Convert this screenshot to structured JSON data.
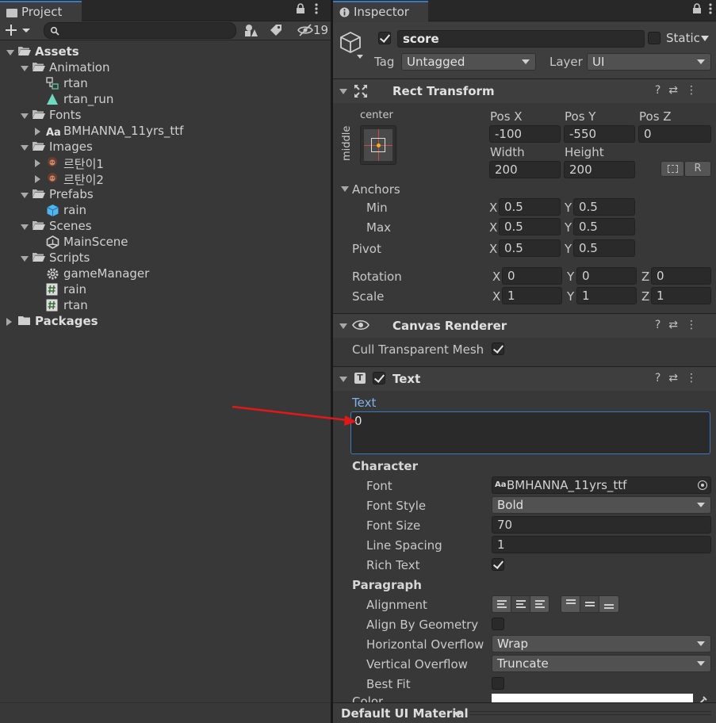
{
  "project": {
    "tab_label": "Project",
    "hidden_count": "19",
    "search_placeholder": "",
    "tree": [
      {
        "label": "Assets",
        "indent": 0,
        "icon": "folder-open-icon",
        "expander": "down",
        "bold": true
      },
      {
        "label": "Animation",
        "indent": 1,
        "icon": "folder-open-icon",
        "expander": "down",
        "bold": false
      },
      {
        "label": "rtan",
        "indent": 2,
        "icon": "animator-controller-icon",
        "expander": "none",
        "bold": false
      },
      {
        "label": "rtan_run",
        "indent": 2,
        "icon": "animation-clip-icon",
        "expander": "none",
        "bold": false
      },
      {
        "label": "Fonts",
        "indent": 1,
        "icon": "folder-open-icon",
        "expander": "down",
        "bold": false
      },
      {
        "label": "BMHANNA_11yrs_ttf",
        "indent": 2,
        "icon": "font-icon",
        "expander": "right",
        "bold": false
      },
      {
        "label": "Images",
        "indent": 1,
        "icon": "folder-open-icon",
        "expander": "down",
        "bold": false
      },
      {
        "label": "르탄이1",
        "indent": 2,
        "icon": "sprite-icon",
        "expander": "right",
        "bold": false
      },
      {
        "label": "르탄이2",
        "indent": 2,
        "icon": "sprite-icon",
        "expander": "right",
        "bold": false
      },
      {
        "label": "Prefabs",
        "indent": 1,
        "icon": "folder-open-icon",
        "expander": "down",
        "bold": false
      },
      {
        "label": "rain",
        "indent": 2,
        "icon": "prefab-icon",
        "expander": "none",
        "bold": false
      },
      {
        "label": "Scenes",
        "indent": 1,
        "icon": "folder-open-icon",
        "expander": "down",
        "bold": false
      },
      {
        "label": "MainScene",
        "indent": 2,
        "icon": "unity-scene-icon",
        "expander": "none",
        "bold": false
      },
      {
        "label": "Scripts",
        "indent": 1,
        "icon": "folder-open-icon",
        "expander": "down",
        "bold": false
      },
      {
        "label": "gameManager",
        "indent": 2,
        "icon": "gear-script-icon",
        "expander": "none",
        "bold": false
      },
      {
        "label": "rain",
        "indent": 2,
        "icon": "csharp-script-icon",
        "expander": "none",
        "bold": false
      },
      {
        "label": "rtan",
        "indent": 2,
        "icon": "csharp-script-icon",
        "expander": "none",
        "bold": false
      },
      {
        "label": "Packages",
        "indent": 0,
        "icon": "folder-closed-icon",
        "expander": "right",
        "bold": true
      }
    ]
  },
  "inspector": {
    "tab_label": "Inspector",
    "object_name": "score",
    "active": true,
    "static_label": "Static",
    "tag_label": "Tag",
    "tag_value": "Untagged",
    "layer_label": "Layer",
    "layer_value": "UI",
    "rect_transform": {
      "title": "Rect Transform",
      "anchor_h": "center",
      "anchor_v": "middle",
      "pos_x_label": "Pos X",
      "pos_y_label": "Pos Y",
      "pos_z_label": "Pos Z",
      "pos_x": "-100",
      "pos_y": "-550",
      "pos_z": "0",
      "width_label": "Width",
      "height_label": "Height",
      "width": "200",
      "height": "200",
      "r_button": "R",
      "anchors_label": "Anchors",
      "min_label": "Min",
      "max_label": "Max",
      "pivot_label": "Pivot",
      "min_x": "0.5",
      "min_y": "0.5",
      "max_x": "0.5",
      "max_y": "0.5",
      "pivot_x": "0.5",
      "pivot_y": "0.5",
      "rotation_label": "Rotation",
      "scale_label": "Scale",
      "rot_x": "0",
      "rot_y": "0",
      "rot_z": "0",
      "scale_x": "1",
      "scale_y": "1",
      "scale_z": "1",
      "x": "X",
      "y": "Y",
      "z": "Z"
    },
    "canvas_renderer": {
      "title": "Canvas Renderer",
      "cull_label": "Cull Transparent Mesh",
      "cull": true
    },
    "text": {
      "title": "Text",
      "enabled": true,
      "text_label": "Text",
      "text_value": "0",
      "character_label": "Character",
      "font_label": "Font",
      "font_value": "BMHANNA_11yrs_ttf",
      "font_style_label": "Font Style",
      "font_style_value": "Bold",
      "font_size_label": "Font Size",
      "font_size_value": "70",
      "line_spacing_label": "Line Spacing",
      "line_spacing_value": "1",
      "rich_text_label": "Rich Text",
      "rich_text": true,
      "paragraph_label": "Paragraph",
      "alignment_label": "Alignment",
      "align_by_geometry_label": "Align By Geometry",
      "align_by_geometry": false,
      "h_overflow_label": "Horizontal Overflow",
      "h_overflow_value": "Wrap",
      "v_overflow_label": "Vertical Overflow",
      "v_overflow_value": "Truncate",
      "best_fit_label": "Best Fit",
      "best_fit": false,
      "color_label": "Color",
      "color_value": "#ffffff"
    },
    "material_footer": "Default UI Material",
    "accent_color": "#3a79bb",
    "annotation_arrow_color": "#e01818"
  }
}
